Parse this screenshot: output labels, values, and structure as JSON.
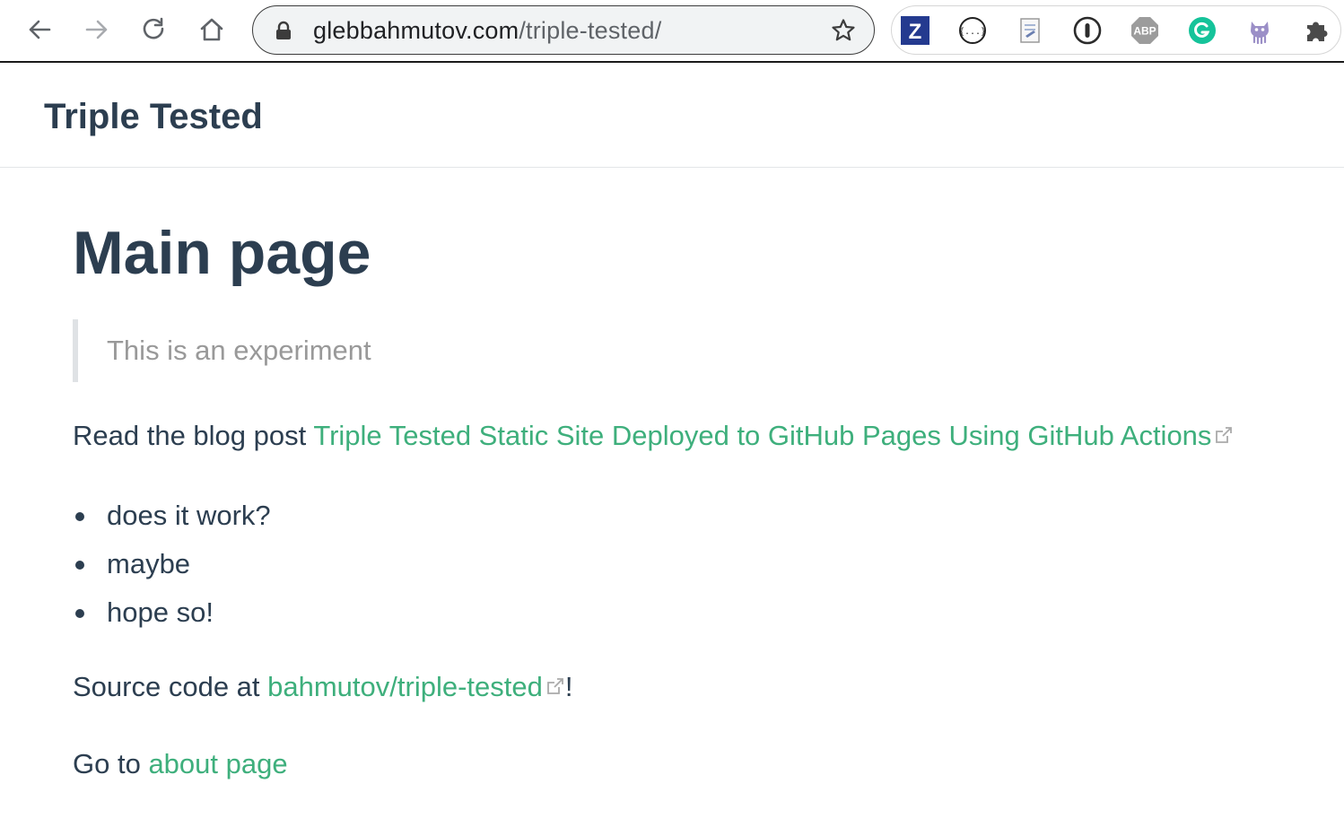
{
  "browser": {
    "url_domain": "glebbahmutov.com",
    "url_path": "/triple-tested/",
    "extensions": [
      {
        "name": "Zotero",
        "label": "Z"
      },
      {
        "name": "JSON viewer",
        "label": "{...}"
      },
      {
        "name": "Page notes"
      },
      {
        "name": "1Password"
      },
      {
        "name": "AdBlock Plus",
        "label": "ABP"
      },
      {
        "name": "Grammarly",
        "label": "G"
      },
      {
        "name": "Octotree"
      },
      {
        "name": "Extensions"
      }
    ],
    "colors": {
      "zotero": "#243a8f",
      "grammarly": "#15c39a",
      "abp": "#9c9c9c"
    }
  },
  "site": {
    "title": "Triple Tested"
  },
  "page": {
    "heading": "Main page",
    "quote": "This is an experiment",
    "blog_prefix": "Read the blog post ",
    "blog_link": "Triple Tested Static Site Deployed to GitHub Pages Using GitHub Actions",
    "bullets": [
      "does it work?",
      "maybe",
      "hope so!"
    ],
    "source_prefix": "Source code at ",
    "source_link": "bahmutov/triple-tested",
    "source_suffix": "!",
    "goto_prefix": "Go to ",
    "goto_link": "about page",
    "accent": "#3eaf7c"
  }
}
